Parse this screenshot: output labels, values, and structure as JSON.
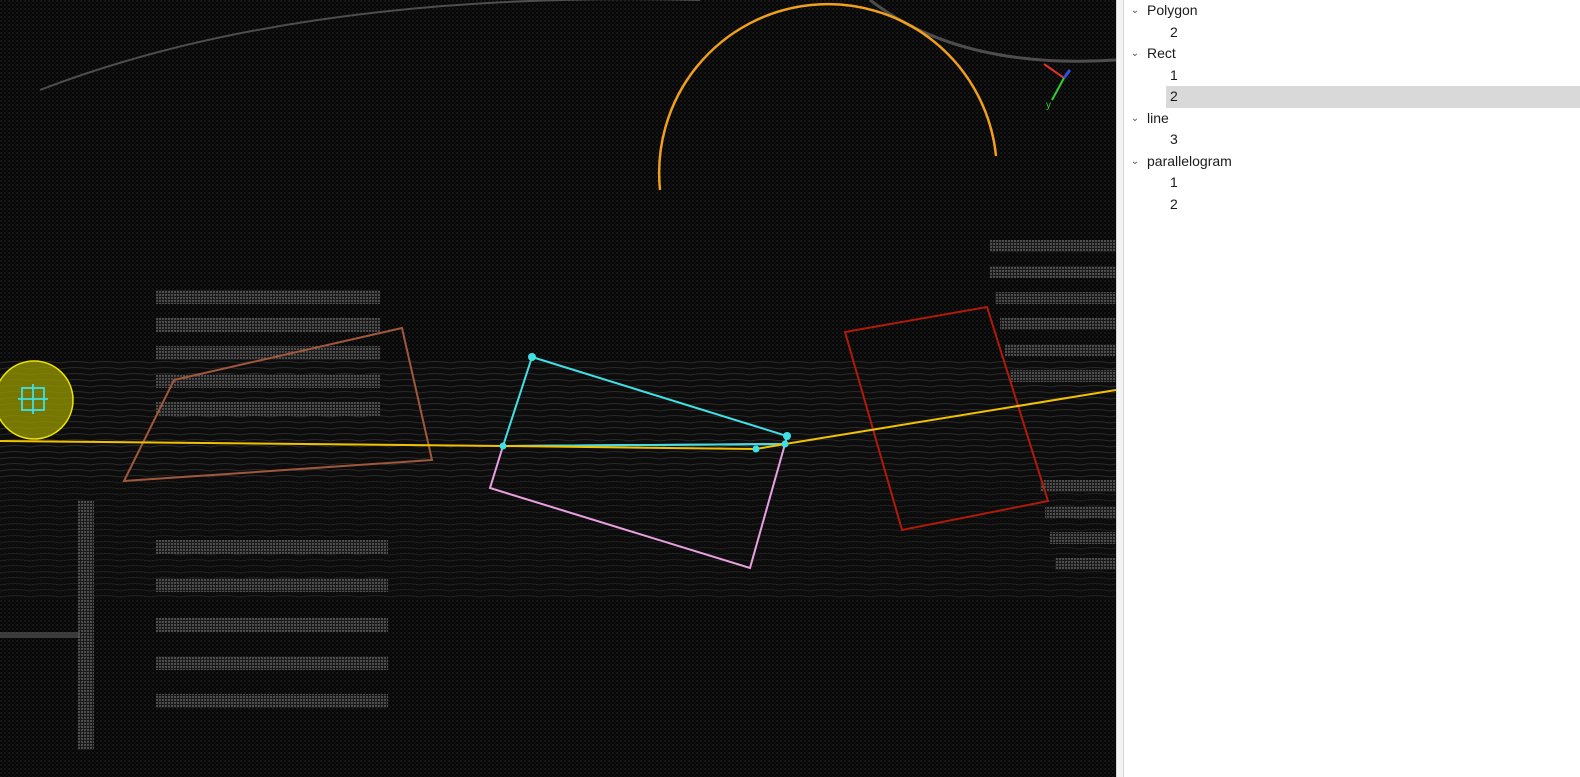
{
  "viewport": {
    "name": "point-cloud-3d-view",
    "colors": {
      "background": "#050505",
      "polyline": "#f2c200",
      "arc": "#f0a01a",
      "polygon_brown": "#a0583c",
      "rect_cyan": "#3fe0e6",
      "rect_pink": "#e9a0e0",
      "rect_red": "#b01a0a",
      "handle": "#3fe0e6",
      "circle_fill": "#9a9a00"
    },
    "axis_gizmo": {
      "x_color": "#e03030",
      "y_color": "#30d030",
      "z_color": "#3050e0",
      "y_label": "y"
    },
    "icons": [
      "move-handle-icon"
    ]
  },
  "tree": {
    "groups": [
      {
        "label": "Polygon",
        "expanded": true,
        "children": [
          {
            "label": "2"
          }
        ]
      },
      {
        "label": "Rect",
        "expanded": true,
        "children": [
          {
            "label": "1"
          },
          {
            "label": "2",
            "selected": true
          }
        ]
      },
      {
        "label": "line",
        "expanded": true,
        "children": [
          {
            "label": "3"
          }
        ]
      },
      {
        "label": "parallelogram",
        "expanded": true,
        "children": [
          {
            "label": "1"
          },
          {
            "label": "2"
          }
        ]
      }
    ]
  }
}
